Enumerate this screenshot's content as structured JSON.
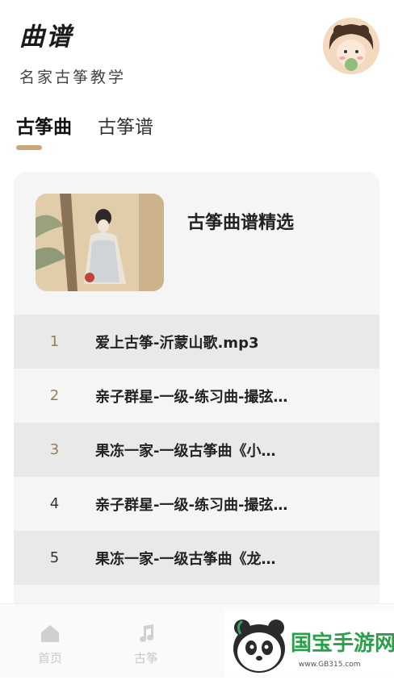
{
  "header": {
    "title": "曲谱",
    "subtitle": "名家古筝教学"
  },
  "tabs": [
    {
      "label": "古筝曲"
    },
    {
      "label": "古筝谱"
    }
  ],
  "panel": {
    "title": "古筝曲谱精选"
  },
  "tracks": [
    {
      "num": "1",
      "name": "爱上古筝-沂蒙山歌.mp3"
    },
    {
      "num": "2",
      "name": "亲子群星-一级-练习曲-撮弦…"
    },
    {
      "num": "3",
      "name": "果冻一家-一级古筝曲《小…"
    },
    {
      "num": "4",
      "name": "亲子群星-一级-练习曲-撮弦…"
    },
    {
      "num": "5",
      "name": "果冻一家-一级古筝曲《龙…"
    }
  ],
  "nav": [
    {
      "label": "首页",
      "icon": "home-icon"
    },
    {
      "label": "古筝",
      "icon": "music-note-icon"
    }
  ],
  "watermark": {
    "brand": "国宝手游网",
    "url": "www.GB315.com"
  },
  "colors": {
    "accent": "#c9a77a",
    "num_gold": "#9a7d55"
  }
}
